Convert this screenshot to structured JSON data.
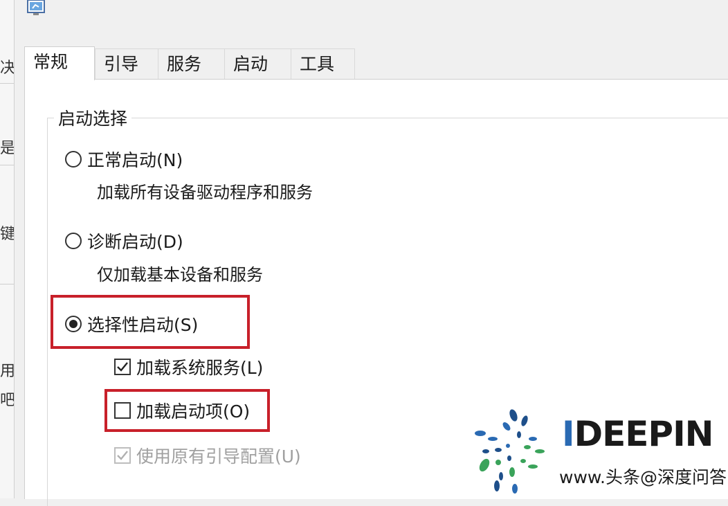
{
  "tabs": [
    {
      "label": "常规",
      "active": true
    },
    {
      "label": "引导",
      "active": false
    },
    {
      "label": "服务",
      "active": false
    },
    {
      "label": "启动",
      "active": false
    },
    {
      "label": "工具",
      "active": false
    }
  ],
  "background_window": {
    "fragments": [
      "决",
      "是",
      "键",
      "用户",
      "吧。"
    ]
  },
  "startup": {
    "group_label": "启动选择",
    "normal": {
      "label": "正常启动(N)",
      "desc": "加载所有设备驱动程序和服务",
      "checked": false
    },
    "diagnostic": {
      "label": "诊断启动(D)",
      "desc": "仅加载基本设备和服务",
      "checked": false
    },
    "selective": {
      "label": "选择性启动(S)",
      "checked": true
    },
    "load_system_services": {
      "label": "加载系统服务(L)",
      "checked": true
    },
    "load_startup_items": {
      "label": "加载启动项(O)",
      "checked": false
    },
    "use_original_boot": {
      "label": "使用原有引导配置(U)",
      "checked": true,
      "disabled": true
    }
  },
  "watermark": {
    "brand_i": "I",
    "brand_rest": "DEEPIN",
    "caption": "www.头条@深度问答"
  },
  "colors": {
    "highlight": "#c8202a",
    "panel": "#ffffff",
    "tab_inactive": "#f0f0f0"
  }
}
